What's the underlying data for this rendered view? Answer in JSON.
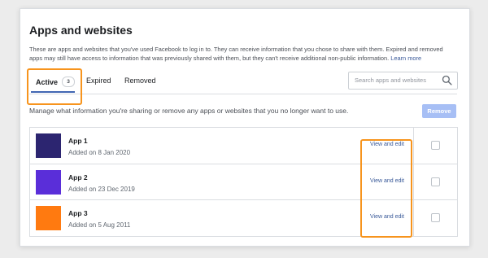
{
  "section": {
    "title": "Apps and websites",
    "description": "These are apps and websites that you've used Facebook to log in to. They can receive information that you chose to share with them. Expired and removed apps may still have access to information that was previously shared with them, but they can't receive additional non-public information.",
    "learn_more": "Learn more"
  },
  "tabs": [
    {
      "label": "Active",
      "count": "3",
      "selected": true
    },
    {
      "label": "Expired"
    },
    {
      "label": "Removed"
    }
  ],
  "search": {
    "placeholder": "Search apps and websites",
    "icon": "magnifier-icon"
  },
  "manage_text": "Manage what information you're sharing or remove any apps or websites that you no longer want to use.",
  "remove_button": "Remove",
  "apps": [
    {
      "name": "App 1",
      "added": "Added on 8 Jan 2020",
      "color": "#2c2570",
      "link": "View and edit"
    },
    {
      "name": "App 2",
      "added": "Added on 23 Dec 2019",
      "color": "#5a2ed9",
      "link": "View and edit"
    },
    {
      "name": "App 3",
      "added": "Added on 5 Aug 2011",
      "color": "#ff7a10",
      "link": "View and edit"
    }
  ],
  "colors": {
    "highlight": "#f7941d",
    "link": "#385898",
    "accent": "#4267b2",
    "remove_disabled": "#a7bff5"
  }
}
